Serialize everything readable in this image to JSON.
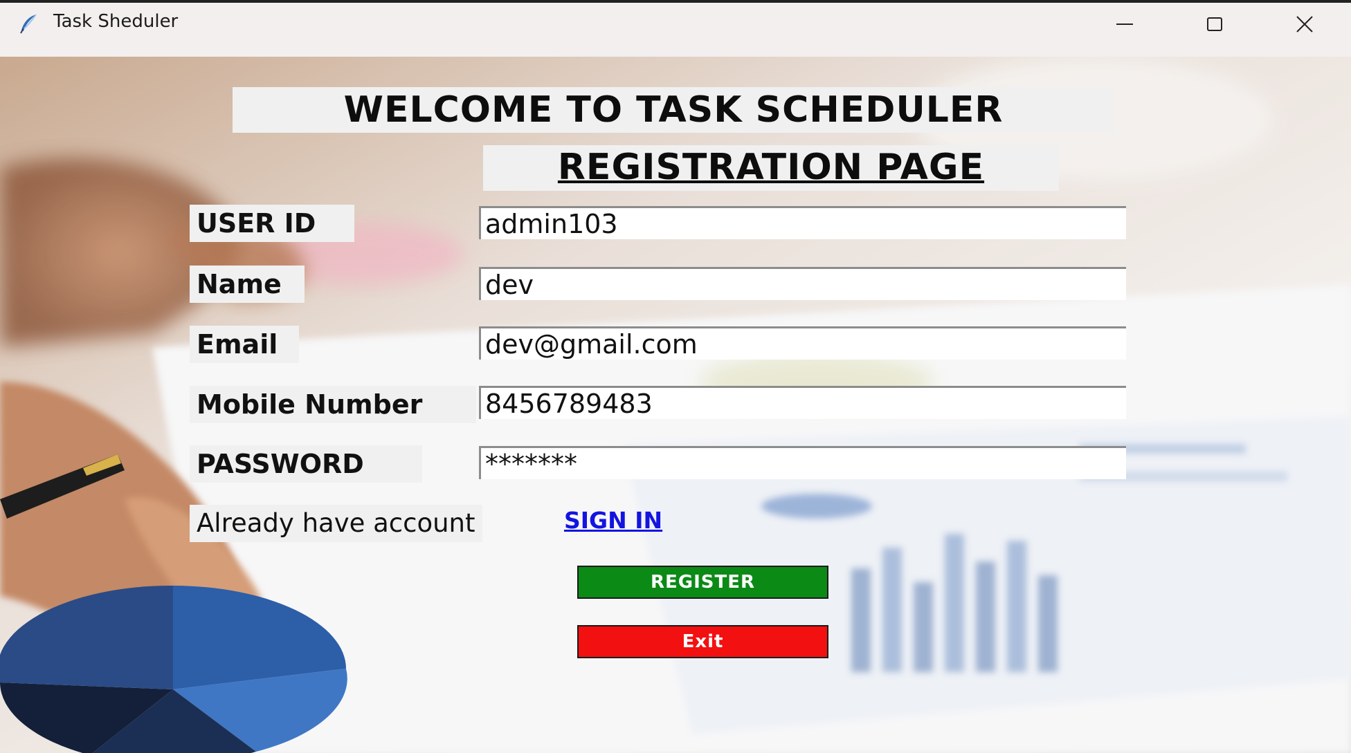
{
  "window": {
    "title": "Task Sheduler",
    "icon": "feather-icon",
    "controls": [
      "minimize-icon",
      "maximize-icon",
      "close-icon"
    ]
  },
  "page": {
    "welcome_title": "WELCOME TO TASK SCHEDULER",
    "page_title": "REGISTRATION PAGE"
  },
  "form": {
    "user_id": {
      "label": "USER ID",
      "value": "admin103"
    },
    "name": {
      "label": "Name",
      "value": "dev"
    },
    "email": {
      "label": "Email",
      "value": "dev@gmail.com"
    },
    "mobile": {
      "label": "Mobile Number",
      "value": "8456789483"
    },
    "password": {
      "label": "PASSWORD",
      "value": "*******"
    }
  },
  "signin": {
    "prompt": "Already have account",
    "link": "SIGN IN"
  },
  "buttons": {
    "register": "REGISTER",
    "exit": "Exit"
  },
  "colors": {
    "register": "#0b8a16",
    "exit": "#f21010",
    "link": "#1414e0"
  }
}
